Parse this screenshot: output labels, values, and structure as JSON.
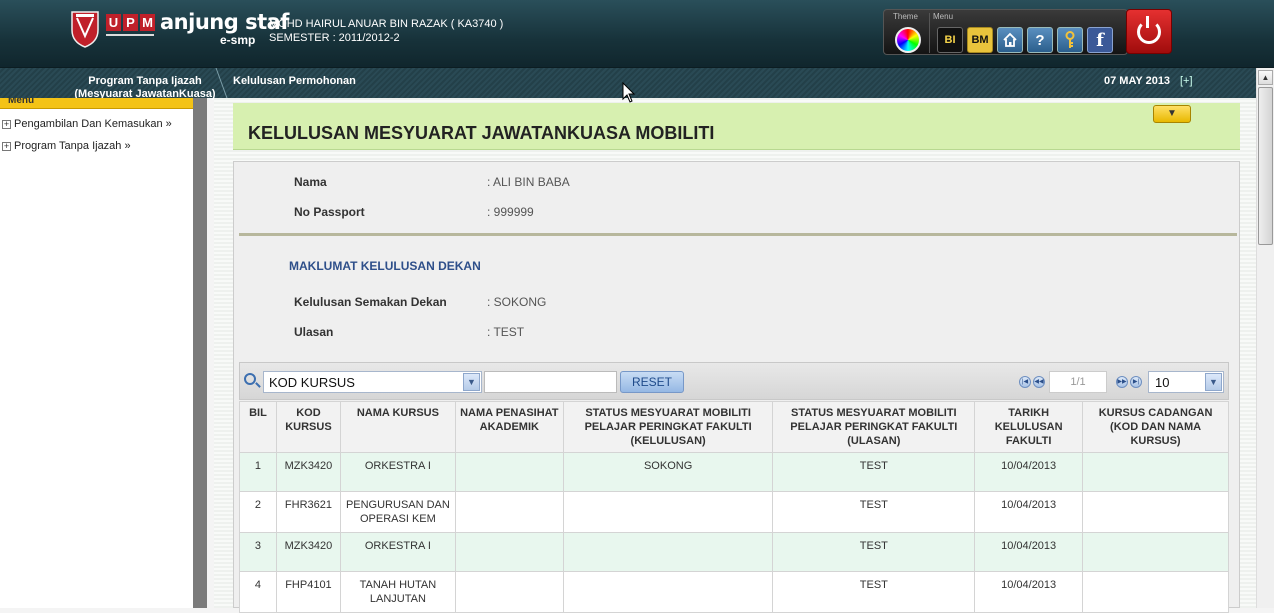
{
  "header": {
    "brand_letters": [
      "U",
      "P",
      "M"
    ],
    "brand_name": "anjung staf",
    "brand_sub": "e-smp",
    "user_name": "MOHD HAIRUL ANUAR BIN RAZAK ( KA3740 )",
    "semester": "SEMESTER : 2011/2012-2",
    "toolbox": {
      "theme_label": "Theme",
      "menu_label": "Menu",
      "bi_label": "BI",
      "bm_label": "BM",
      "help_label": "?",
      "fb_label": "f"
    },
    "icons": [
      "shield-logo-icon",
      "color-wheel-icon",
      "home-icon",
      "help-icon",
      "key-icon",
      "facebook-icon",
      "power-icon"
    ]
  },
  "breadcrumb": {
    "item1": "Program Tanpa Ijazah (Mesyuarat JawatanKuasa)",
    "item2": "Kelulusan Permohonan",
    "date": "07 MAY 2013",
    "toggle": "[+]"
  },
  "sidebar": {
    "title": "Menu",
    "items": [
      {
        "label": "Pengambilan Dan Kemasukan »"
      },
      {
        "label": "Program Tanpa Ijazah »"
      }
    ]
  },
  "main": {
    "page_title": "KELULUSAN MESYUARAT JAWATANKUASA MOBILITI",
    "collapse_label": "▼",
    "student": {
      "name_label": "Nama",
      "name_value": ": ALI BIN BABA",
      "passport_label": "No Passport",
      "passport_value": ": 999999"
    },
    "dean_section": {
      "heading": "MAKLUMAT KELULUSAN DEKAN",
      "approval_label": "Kelulusan Semakan Dekan",
      "approval_value": ": SOKONG",
      "remark_label": "Ulasan",
      "remark_value": ": TEST"
    },
    "grid": {
      "search_field": "KOD KURSUS",
      "filter_value": "",
      "reset_label": "RESET",
      "page_info": "1/1",
      "rows_per_page": "10",
      "columns": [
        "BIL",
        "KOD KURSUS",
        "NAMA KURSUS",
        "NAMA PENASIHAT AKADEMIK",
        "STATUS MESYUARAT MOBILITI PELAJAR PERINGKAT FAKULTI (KELULUSAN)",
        "STATUS MESYUARAT MOBILITI PELAJAR PERINGKAT FAKULTI (ULASAN)",
        "TARIKH KELULUSAN FAKULTI",
        "KURSUS CADANGAN (KOD DAN NAMA KURSUS)"
      ],
      "rows": [
        [
          "1",
          "MZK3420",
          "ORKESTRA I",
          "",
          "SOKONG",
          "TEST",
          "10/04/2013",
          ""
        ],
        [
          "2",
          "FHR3621",
          "PENGURUSAN DAN OPERASI KEM",
          "",
          "",
          "TEST",
          "10/04/2013",
          ""
        ],
        [
          "3",
          "MZK3420",
          "ORKESTRA I",
          "",
          "",
          "TEST",
          "10/04/2013",
          ""
        ],
        [
          "4",
          "FHP4101",
          "TANAH HUTAN LANJUTAN",
          "",
          "",
          "TEST",
          "10/04/2013",
          ""
        ]
      ]
    }
  },
  "colors": {
    "header_bg": "#17323a",
    "title_band": "#d7f0b0",
    "row_alt": "#e8f7ee",
    "section_heading": "#2e4f8a",
    "logout": "#c81818",
    "menu_bar": "#f4c316"
  }
}
